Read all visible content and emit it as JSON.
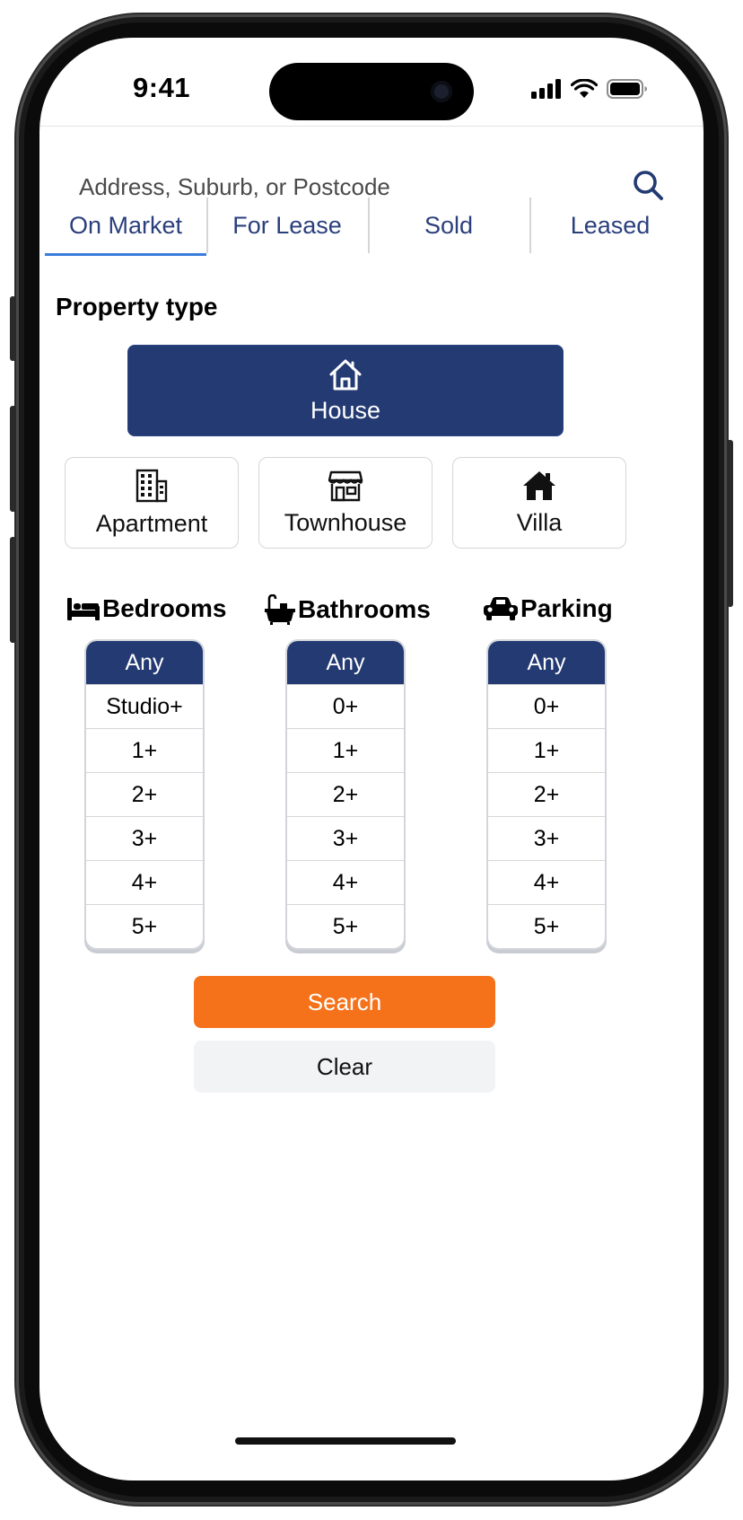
{
  "status_bar": {
    "time": "9:41"
  },
  "search": {
    "placeholder": "Address, Suburb, or Postcode"
  },
  "tabs": [
    {
      "label": "On Market",
      "active": true
    },
    {
      "label": "For Lease",
      "active": false
    },
    {
      "label": "Sold",
      "active": false
    },
    {
      "label": "Leased",
      "active": false
    }
  ],
  "property_type": {
    "title": "Property type",
    "selected": "House",
    "house": "House",
    "apartment": "Apartment",
    "townhouse": "Townhouse",
    "villa": "Villa"
  },
  "filters": {
    "bedrooms": {
      "title": "Bedrooms",
      "options": [
        "Any",
        "Studio+",
        "1+",
        "2+",
        "3+",
        "4+",
        "5+"
      ],
      "selected": "Any"
    },
    "bathrooms": {
      "title": "Bathrooms",
      "options": [
        "Any",
        "0+",
        "1+",
        "2+",
        "3+",
        "4+",
        "5+"
      ],
      "selected": "Any"
    },
    "parking": {
      "title": "Parking",
      "options": [
        "Any",
        "0+",
        "1+",
        "2+",
        "3+",
        "4+",
        "5+"
      ],
      "selected": "Any"
    }
  },
  "actions": {
    "search": "Search",
    "clear": "Clear"
  },
  "colors": {
    "primary": "#233a72",
    "accent": "#f5721b",
    "tab_text": "#2a3f7c",
    "tab_underline": "#3b7ddd"
  },
  "icons": [
    "search-icon",
    "house-icon",
    "building-icon",
    "store-icon",
    "home-solid-icon",
    "bed-icon",
    "bath-icon",
    "car-icon",
    "signal-icon",
    "wifi-icon",
    "battery-icon"
  ]
}
